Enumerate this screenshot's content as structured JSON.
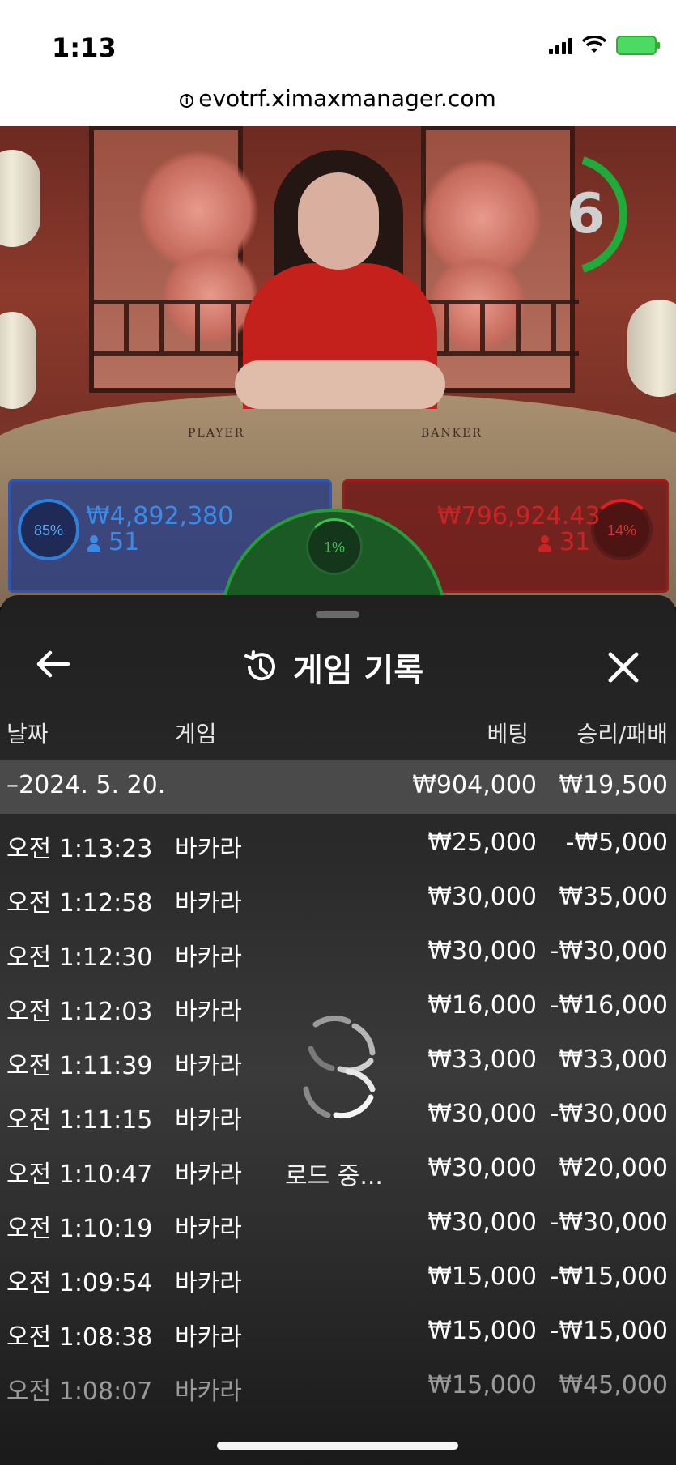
{
  "status_bar": {
    "time": "1:13"
  },
  "browser": {
    "url": "evotrf.ximaxmanager.com"
  },
  "stream": {
    "countdown": "6",
    "table_player_label": "PLAYER",
    "table_banker_label": "BANKER"
  },
  "bets": {
    "player": {
      "percent": "85%",
      "amount": "₩4,892,380",
      "count": "51"
    },
    "banker": {
      "percent": "14%",
      "amount": "₩796,924.43",
      "count": "31"
    },
    "tie": {
      "percent": "1%"
    }
  },
  "sheet": {
    "title": "게임 기록",
    "columns": {
      "date": "날짜",
      "game": "게임",
      "bet": "베팅",
      "result": "승리/패배"
    },
    "date_group": {
      "label": "–2024. 5. 20.",
      "bet_total": "₩904,000",
      "result_total": "₩19,500"
    },
    "rows": [
      {
        "time": "오전 1:13:23",
        "game": "바카라",
        "bet": "₩25,000",
        "result": "-₩5,000"
      },
      {
        "time": "오전 1:12:58",
        "game": "바카라",
        "bet": "₩30,000",
        "result": "₩35,000"
      },
      {
        "time": "오전 1:12:30",
        "game": "바카라",
        "bet": "₩30,000",
        "result": "-₩30,000"
      },
      {
        "time": "오전 1:12:03",
        "game": "바카라",
        "bet": "₩16,000",
        "result": "-₩16,000"
      },
      {
        "time": "오전 1:11:39",
        "game": "바카라",
        "bet": "₩33,000",
        "result": "₩33,000"
      },
      {
        "time": "오전 1:11:15",
        "game": "바카라",
        "bet": "₩30,000",
        "result": "-₩30,000"
      },
      {
        "time": "오전 1:10:47",
        "game": "바카라",
        "bet": "₩30,000",
        "result": "₩20,000"
      },
      {
        "time": "오전 1:10:19",
        "game": "바카라",
        "bet": "₩30,000",
        "result": "-₩30,000"
      },
      {
        "time": "오전 1:09:54",
        "game": "바카라",
        "bet": "₩15,000",
        "result": "-₩15,000"
      },
      {
        "time": "오전 1:08:38",
        "game": "바카라",
        "bet": "₩15,000",
        "result": "-₩15,000"
      },
      {
        "time": "오전 1:08:07",
        "game": "바카라",
        "bet": "₩15,000",
        "result": "₩45,000"
      }
    ],
    "loading_text": "로드 중..."
  },
  "icons": {
    "back": "arrow-left-icon",
    "close": "close-icon",
    "history": "history-icon",
    "loader": "loading-spinner-icon"
  },
  "colors": {
    "player": "#2f80d8",
    "banker": "#d83030",
    "tie": "#3fbf50",
    "sheet_bg": "#2a2a2a"
  }
}
